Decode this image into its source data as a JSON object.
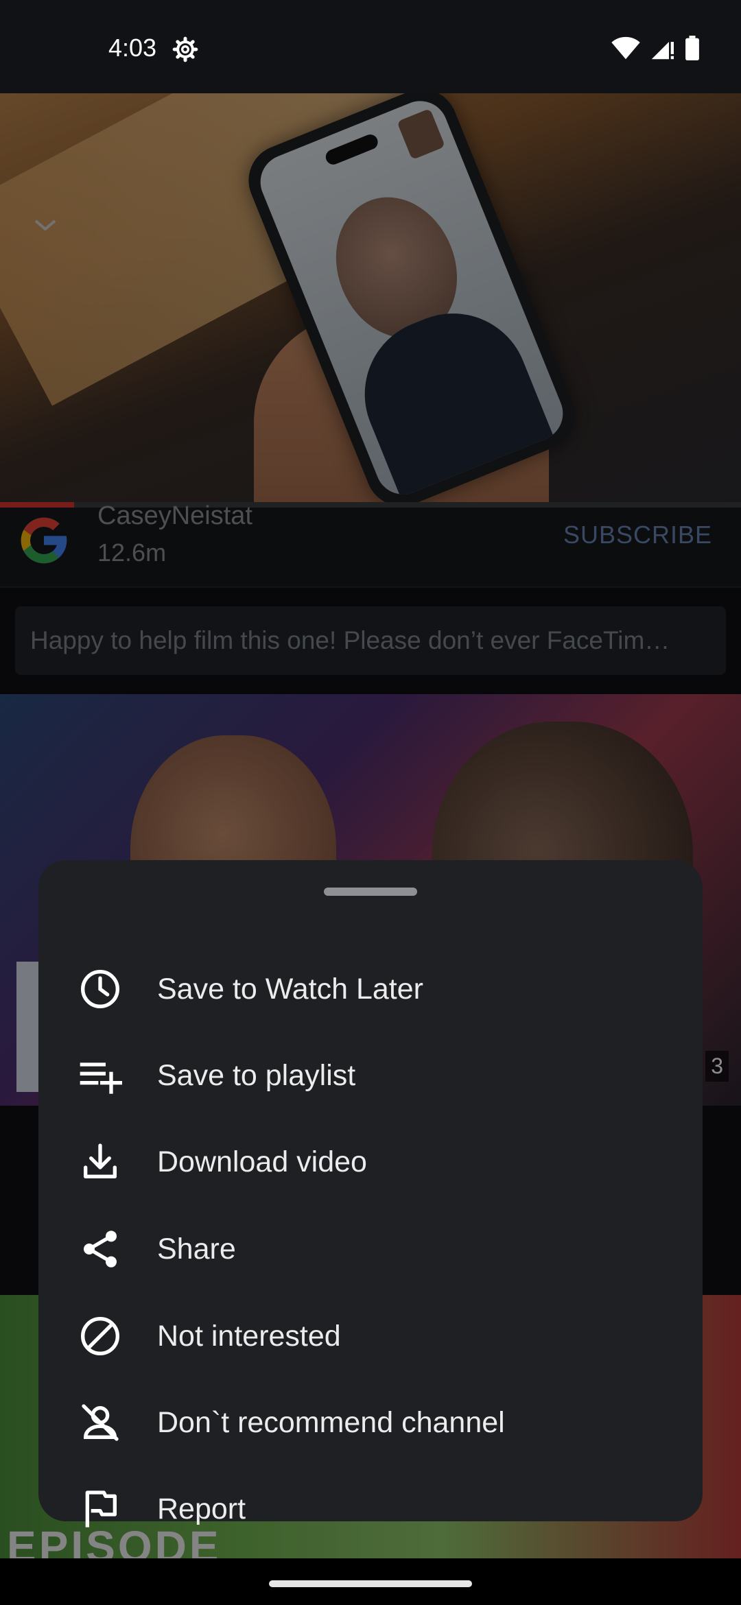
{
  "status_bar": {
    "time": "4:03"
  },
  "video": {
    "progress_fraction": 0.1
  },
  "channel": {
    "name": "CaseyNeistat",
    "subscribers": "12.6m",
    "subscribe_label": "SUBSCRIBE"
  },
  "comment": {
    "text": "Happy to help film this one! Please don’t ever FaceTim…"
  },
  "thumbnail2": {
    "duration_fragment": "3"
  },
  "thumbnail3": {
    "caption_fragment": "EPISODE"
  },
  "menu": {
    "items": [
      {
        "label": "Save to Watch Later",
        "icon": "clock-icon"
      },
      {
        "label": "Save to playlist",
        "icon": "playlist-add-icon"
      },
      {
        "label": "Download video",
        "icon": "download-icon"
      },
      {
        "label": "Share",
        "icon": "share-icon"
      },
      {
        "label": "Not interested",
        "icon": "block-icon"
      },
      {
        "label": "Don`t recommend channel",
        "icon": "person-off-icon"
      },
      {
        "label": "Report",
        "icon": "flag-icon"
      }
    ]
  },
  "colors": {
    "subscribe": "#6a86b4",
    "sheet_bg": "#1f2024",
    "progress": "#dd3333"
  }
}
